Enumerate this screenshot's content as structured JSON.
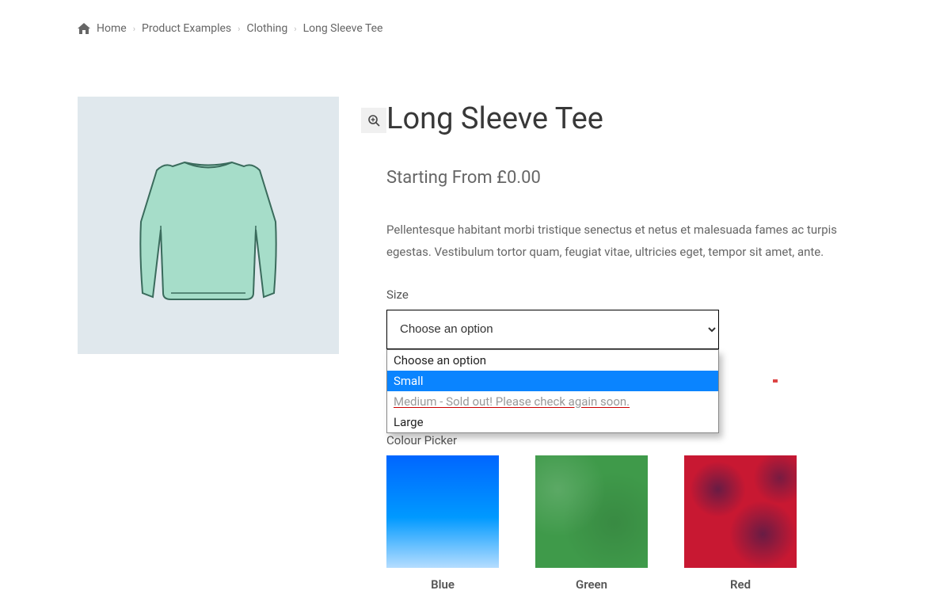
{
  "breadcrumb": {
    "items": [
      "Home",
      "Product Examples",
      "Clothing",
      "Long Sleeve Tee"
    ]
  },
  "product": {
    "title": "Long Sleeve Tee",
    "price_label": "Starting From £0.00",
    "description": "Pellentesque habitant morbi tristique senectus et netus et malesuada fames ac turpis egestas. Vestibulum tortor quam, feugiat vitae, ultricies eget, tempor sit amet, ante."
  },
  "size": {
    "label": "Size",
    "selected": "Choose an option",
    "options": [
      {
        "label": "Choose an option",
        "state": "default"
      },
      {
        "label": "Small",
        "state": "highlighted"
      },
      {
        "label": "Medium - Sold out! Please check again soon.",
        "state": "disabled"
      },
      {
        "label": "Large",
        "state": "default"
      }
    ]
  },
  "colour": {
    "label": "Colour Picker",
    "swatches": [
      {
        "name": "Blue"
      },
      {
        "name": "Green"
      },
      {
        "name": "Red"
      }
    ]
  }
}
